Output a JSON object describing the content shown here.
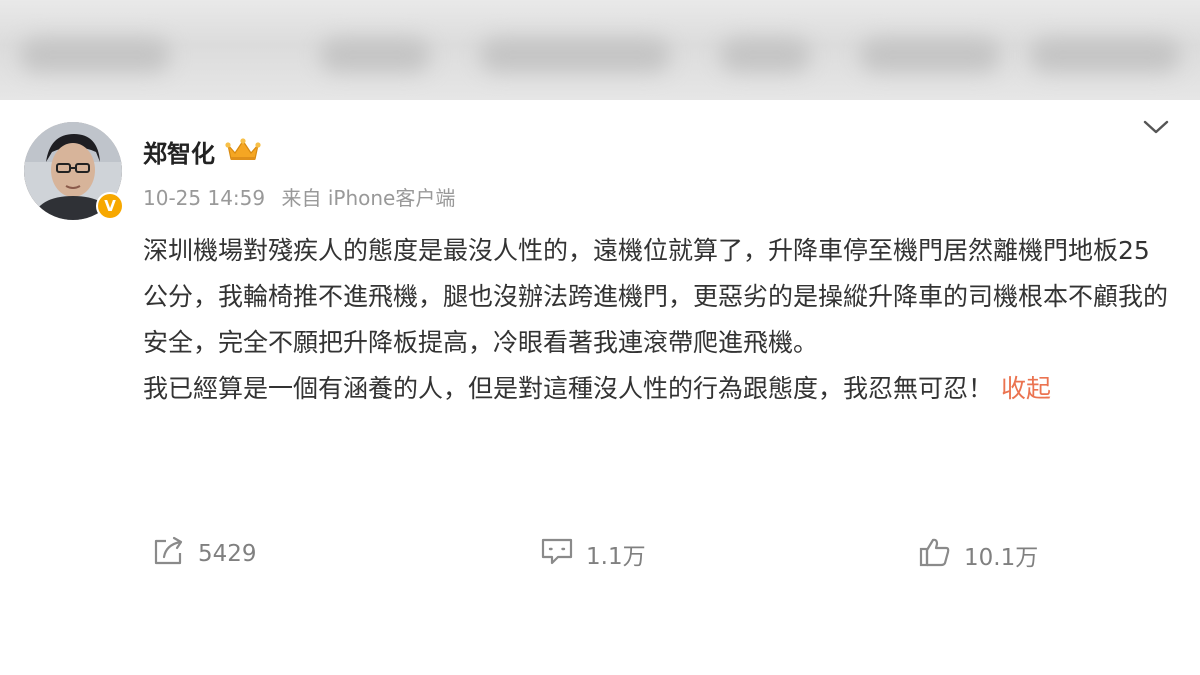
{
  "post": {
    "author": "郑智化",
    "timestamp": "10-25 14:59",
    "source": "来自 iPhone客户端",
    "content_p1": "深圳機場對殘疾人的態度是最沒人性的，遠機位就算了，升降車停至機門居然離機門地板25公分，我輪椅推不進飛機，腿也沒辦法跨進機門，更惡劣的是操縱升降車的司機根本不顧我的安全，完全不願把升降板提高，冷眼看著我連滾帶爬進飛機。",
    "content_p2": "我已經算是一個有涵養的人，但是對這種沒人性的行為跟態度，我忍無可忍！",
    "collapse_label": "收起"
  },
  "actions": {
    "repost_count": "5429",
    "comment_count": "1.1万",
    "like_count": "10.1万"
  },
  "icons": {
    "verified": "verified-v-badge",
    "crown": "crown-member-icon",
    "menu": "chevron-down-icon",
    "repost": "repost-icon",
    "comment": "comment-icon",
    "like": "thumbs-up-icon"
  },
  "colors": {
    "accent": "#eb7350",
    "verified": "#f7a800",
    "crown": "#f5a623",
    "text": "#333333",
    "meta": "#999999"
  }
}
